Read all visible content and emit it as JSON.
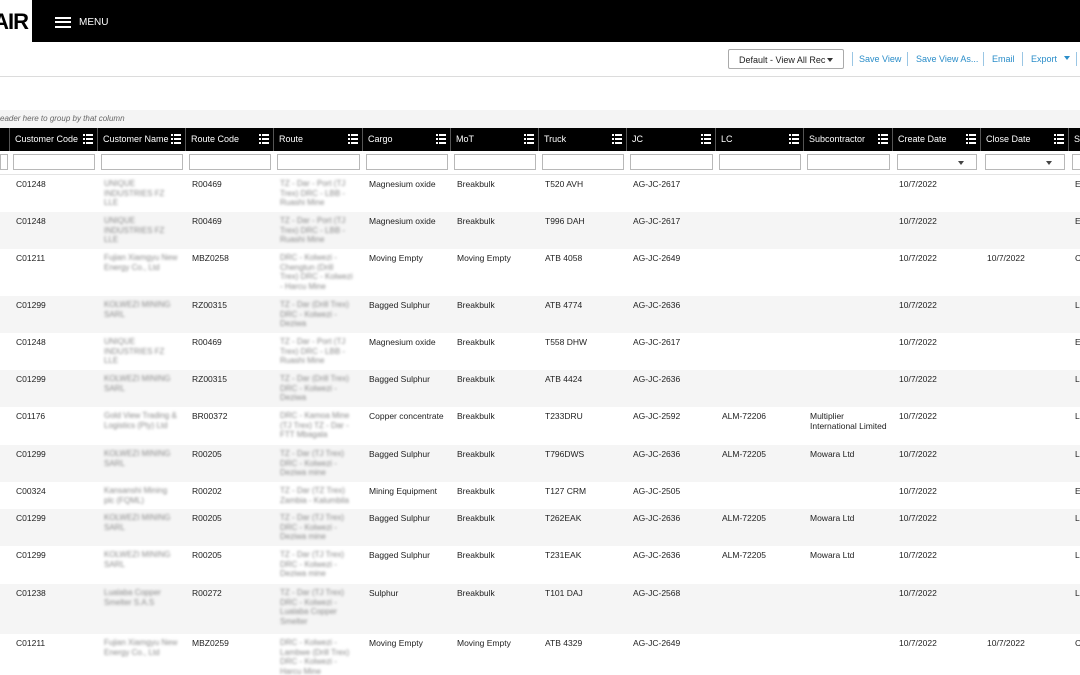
{
  "app": {
    "logo_text": "AIR",
    "menu_label": "MENU"
  },
  "toolbar": {
    "view_select": "Default - View All Rec",
    "save_view": "Save View",
    "save_view_as": "Save View As...",
    "email": "Email",
    "export": "Export"
  },
  "group_hint": "eader here to group by that column",
  "columns": [
    "",
    "Customer Code",
    "Customer Name",
    "Route Code",
    "Route",
    "Cargo",
    "MoT",
    "Truck",
    "JC",
    "LC",
    "Subcontractor",
    "Create Date",
    "Close Date",
    "S"
  ],
  "rows": [
    {
      "customer_code": "C01248",
      "customer_name": "UNIQUE\nINDUSTRIES FZ\nLLE",
      "route_code": "R00469",
      "route": "TZ - Dar - Port (TJ\nTrex) DRC - LBB -\nRuashi Mine",
      "cargo": "Magnesium oxide",
      "mot": "Breakbulk",
      "truck": "T520 AVH",
      "jc": "AG-JC-2617",
      "lc": "",
      "subcontractor": "",
      "create_date": "10/7/2022",
      "close_date": "",
      "s": "E"
    },
    {
      "customer_code": "C01248",
      "customer_name": "UNIQUE\nINDUSTRIES FZ\nLLE",
      "route_code": "R00469",
      "route": "TZ - Dar - Port (TJ\nTrex) DRC - LBB -\nRuashi Mine",
      "cargo": "Magnesium oxide",
      "mot": "Breakbulk",
      "truck": "T996 DAH",
      "jc": "AG-JC-2617",
      "lc": "",
      "subcontractor": "",
      "create_date": "10/7/2022",
      "close_date": "",
      "s": "E"
    },
    {
      "customer_code": "C01211",
      "customer_name": "Fujian Xiamgyu New\nEnergy Co., Ltd",
      "route_code": "MBZ0258",
      "route": "DRC - Kolwezi -\nChengtun (Drill\nTrex) DRC - Kolwezi\n- Harcu Mine",
      "cargo": "Moving Empty",
      "mot": "Moving Empty",
      "truck": "ATB 4058",
      "jc": "AG-JC-2649",
      "lc": "",
      "subcontractor": "",
      "create_date": "10/7/2022",
      "close_date": "10/7/2022",
      "s": "C"
    },
    {
      "customer_code": "C01299",
      "customer_name": "KOLWEZI MINING\nSARL",
      "route_code": "RZ00315",
      "route": "TZ - Dar (Drill Trex)\nDRC - Kolwezi -\nDeziwa",
      "cargo": "Bagged Sulphur",
      "mot": "Breakbulk",
      "truck": "ATB 4774",
      "jc": "AG-JC-2636",
      "lc": "",
      "subcontractor": "",
      "create_date": "10/7/2022",
      "close_date": "",
      "s": "L"
    },
    {
      "customer_code": "C01248",
      "customer_name": "UNIQUE\nINDUSTRIES FZ\nLLE",
      "route_code": "R00469",
      "route": "TZ - Dar - Port (TJ\nTrex) DRC - LBB -\nRuashi Mine",
      "cargo": "Magnesium oxide",
      "mot": "Breakbulk",
      "truck": "T558 DHW",
      "jc": "AG-JC-2617",
      "lc": "",
      "subcontractor": "",
      "create_date": "10/7/2022",
      "close_date": "",
      "s": "E"
    },
    {
      "customer_code": "C01299",
      "customer_name": "KOLWEZI MINING\nSARL",
      "route_code": "RZ00315",
      "route": "TZ - Dar (Drill Trex)\nDRC - Kolwezi -\nDeziwa",
      "cargo": "Bagged Sulphur",
      "mot": "Breakbulk",
      "truck": "ATB 4424",
      "jc": "AG-JC-2636",
      "lc": "",
      "subcontractor": "",
      "create_date": "10/7/2022",
      "close_date": "",
      "s": "L"
    },
    {
      "customer_code": "C01176",
      "customer_name": "Gold View Trading &\nLogistics (Pty) Ltd",
      "route_code": "BR00372",
      "route": "DRC - Kamoa Mine\n(TJ Trex) TZ - Dar -\nFTT Mbagala",
      "cargo": "Copper concentrate",
      "mot": "Breakbulk",
      "truck": "T233DRU",
      "jc": "AG-JC-2592",
      "lc": "ALM-72206",
      "subcontractor": "Multiplier\nInternational Limited",
      "create_date": "10/7/2022",
      "close_date": "",
      "s": "L"
    },
    {
      "customer_code": "C01299",
      "customer_name": "KOLWEZI MINING\nSARL",
      "route_code": "R00205",
      "route": "TZ - Dar (TJ Trex)\nDRC - Kolwezi -\nDeziwa mine",
      "cargo": "Bagged Sulphur",
      "mot": "Breakbulk",
      "truck": "T796DWS",
      "jc": "AG-JC-2636",
      "lc": "ALM-72205",
      "subcontractor": "Mowara Ltd",
      "create_date": "10/7/2022",
      "close_date": "",
      "s": "L"
    },
    {
      "customer_code": "C00324",
      "customer_name": "Kansanshi Mining\nplc (FQML)",
      "route_code": "R00202",
      "route": "TZ - Dar (TZ Trex)\nZambia - Kalumbila",
      "cargo": "Mining Equipment",
      "mot": "Breakbulk",
      "truck": "T127 CRM",
      "jc": "AG-JC-2505",
      "lc": "",
      "subcontractor": "",
      "create_date": "10/7/2022",
      "close_date": "",
      "s": "E"
    },
    {
      "customer_code": "C01299",
      "customer_name": "KOLWEZI MINING\nSARL",
      "route_code": "R00205",
      "route": "TZ - Dar (TJ Trex)\nDRC - Kolwezi -\nDeziwa mine",
      "cargo": "Bagged Sulphur",
      "mot": "Breakbulk",
      "truck": "T262EAK",
      "jc": "AG-JC-2636",
      "lc": "ALM-72205",
      "subcontractor": "Mowara Ltd",
      "create_date": "10/7/2022",
      "close_date": "",
      "s": "L"
    },
    {
      "customer_code": "C01299",
      "customer_name": "KOLWEZI MINING\nSARL",
      "route_code": "R00205",
      "route": "TZ - Dar (TJ Trex)\nDRC - Kolwezi -\nDeziwa mine",
      "cargo": "Bagged Sulphur",
      "mot": "Breakbulk",
      "truck": "T231EAK",
      "jc": "AG-JC-2636",
      "lc": "ALM-72205",
      "subcontractor": "Mowara Ltd",
      "create_date": "10/7/2022",
      "close_date": "",
      "s": "L"
    },
    {
      "customer_code": "C01238",
      "customer_name": "Lualaba Copper\nSmelter S.A.S",
      "route_code": "R00272",
      "route": "TZ - Dar (TJ Trex)\nDRC - Kolwezi -\nLualaba Copper\nSmelter",
      "cargo": "Sulphur",
      "mot": "Breakbulk",
      "truck": "T101 DAJ",
      "jc": "AG-JC-2568",
      "lc": "",
      "subcontractor": "",
      "create_date": "10/7/2022",
      "close_date": "",
      "s": "L"
    },
    {
      "customer_code": "C01211",
      "customer_name": "Fujian Xiamgyu New\nEnergy Co., Ltd",
      "route_code": "MBZ0259",
      "route": "DRC - Kolwezi -\nLambwe (Drill Trex)\nDRC - Kolwezi -\nHarcu Mine",
      "cargo": "Moving Empty",
      "mot": "Moving Empty",
      "truck": "ATB 4329",
      "jc": "AG-JC-2649",
      "lc": "",
      "subcontractor": "",
      "create_date": "10/7/2022",
      "close_date": "10/7/2022",
      "s": "C"
    }
  ]
}
